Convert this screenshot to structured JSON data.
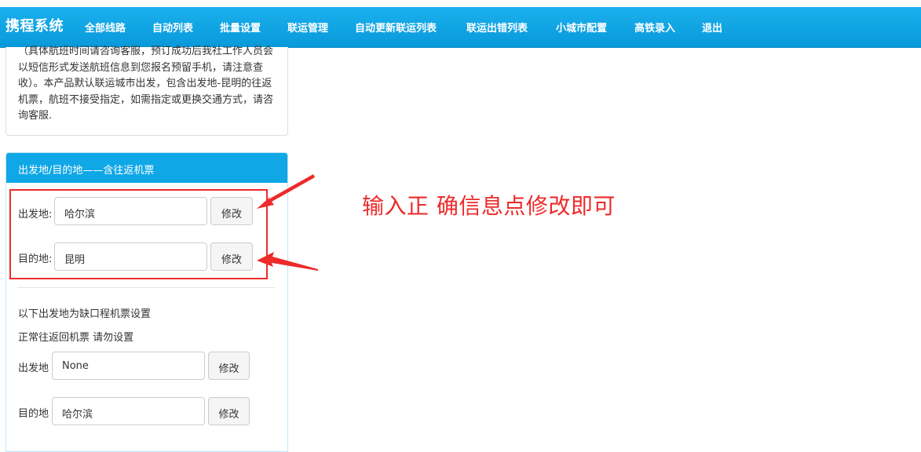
{
  "nav": {
    "brand": "携程系统",
    "items": [
      "全部线路",
      "自动列表",
      "批量设置",
      "联运管理",
      "自动更新联运列表",
      "联运出错列表",
      "小城市配置",
      "高铁录入",
      "退出"
    ]
  },
  "description": "（具体航班时间请咨询客服，预订成功后我社工作人员会以短信形式发送航班信息到您报名预留手机，请注意查收）。本产品默认联运城市出发，包含出发地-昆明的往返机票，航班不接受指定，如需指定或更换交通方式，请咨询客服.",
  "panel": {
    "title": "出发地/目的地——含往返机票",
    "departure_label": "出发地:",
    "departure_value": "哈尔滨",
    "destination_label": "目的地:",
    "destination_value": "昆明",
    "modify_label": "修改"
  },
  "lower": {
    "note1": "以下出发地为缺口程机票设置",
    "note2": "正常往返回机票 请勿设置",
    "departure_label": "出发地",
    "departure_value": "None",
    "destination_label": "目的地",
    "destination_value": "哈尔滨",
    "modify_label": "修改"
  },
  "annotation": "输入正 确信息点修改即可",
  "colors": {
    "nav": "#0fa3e3",
    "annotation": "#ee2a2a"
  }
}
